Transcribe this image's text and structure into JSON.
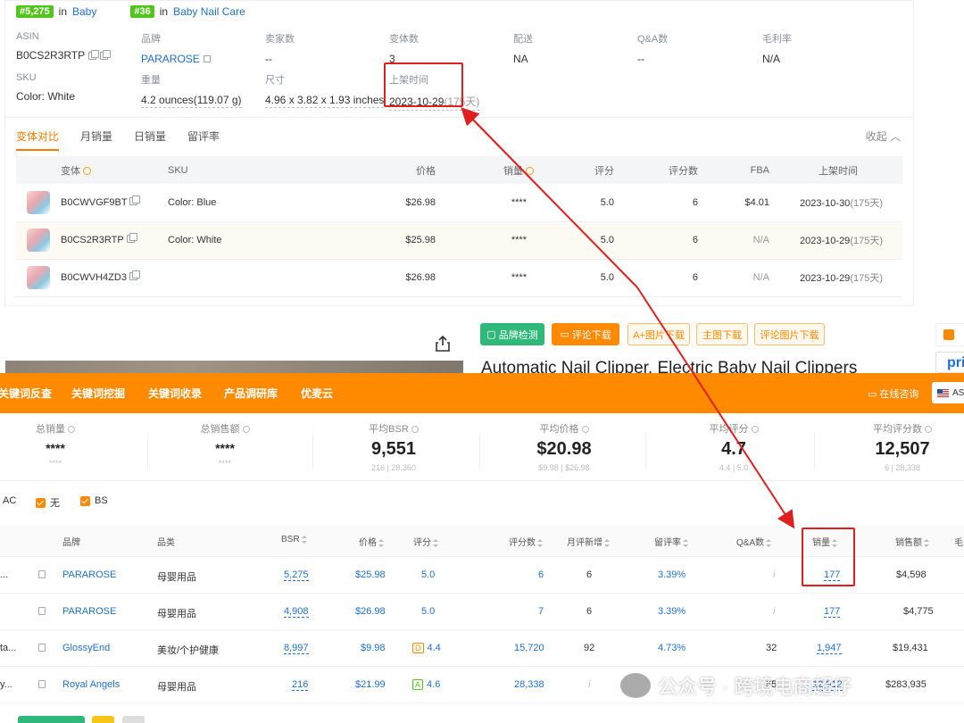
{
  "ranks": [
    {
      "rank": "#5,275",
      "in": "in",
      "category": "Baby"
    },
    {
      "rank": "#36",
      "in": "in",
      "category": "Baby Nail Care"
    }
  ],
  "info": {
    "asin": {
      "label": "ASIN",
      "value": "B0CS2R3RTP"
    },
    "brand": {
      "label": "品牌",
      "value": "PARAROSE"
    },
    "seller_count": {
      "label": "卖家数",
      "value": "--"
    },
    "variant_count": {
      "label": "变体数",
      "value": "3"
    },
    "delivery": {
      "label": "配送",
      "value": "NA"
    },
    "qa_count": {
      "label": "Q&A数",
      "value": "--"
    },
    "margin": {
      "label": "毛利率",
      "value": "N/A"
    },
    "sku": {
      "label": "SKU",
      "value": "Color: White"
    },
    "weight": {
      "label": "重量",
      "value": "4.2 ounces(119.07 g)"
    },
    "size": {
      "label": "尺寸",
      "value": "4.96 x 3.82 x 1.93 inches"
    },
    "listing_date": {
      "label": "上架时间",
      "value": "2023-10-29",
      "suffix": "(175天)"
    }
  },
  "tabs": [
    "变体对比",
    "月销量",
    "日销量",
    "留评率"
  ],
  "collapse_label": "收起",
  "variant_table": {
    "headers": [
      "变体",
      "SKU",
      "价格",
      "销量",
      "评分",
      "评分数",
      "FBA",
      "上架时间"
    ],
    "rows": [
      {
        "asin": "B0CWVGF9BT",
        "sku": "Color: Blue",
        "price": "$26.98",
        "sales": "****",
        "rating": "5.0",
        "reviews": "6",
        "fba": "$4.01",
        "date": "2023-10-30",
        "days": "(175天)"
      },
      {
        "asin": "B0CS2R3RTP",
        "sku": "Color: White",
        "price": "$25.98",
        "sales": "****",
        "rating": "5.0",
        "reviews": "6",
        "fba": "N/A",
        "date": "2023-10-29",
        "days": "(175天)"
      },
      {
        "asin": "B0CWVH4ZD3",
        "sku": "",
        "price": "$26.98",
        "sales": "****",
        "rating": "5.0",
        "reviews": "6",
        "fba": "N/A",
        "date": "2023-10-29",
        "days": "(175天)"
      }
    ]
  },
  "tool_buttons": [
    "品牌检测",
    "评论下载",
    "A+图片下载",
    "主图下载",
    "评论图片下载"
  ],
  "product_title": "Automatic Nail Clipper, Electric Baby Nail Clippers",
  "right_card_text": "pri",
  "nav": {
    "items": [
      "关键词反查",
      "关键词挖掘",
      "关键词收录",
      "产品调研库",
      "优麦云"
    ],
    "consult": "在线咨询",
    "country": "AS"
  },
  "stats": [
    {
      "label": "总销量",
      "value": "****",
      "sub": "****"
    },
    {
      "label": "总销售额",
      "value": "****",
      "sub": "****"
    },
    {
      "label": "平均BSR",
      "value": "9,551",
      "sub": "216 | 28,360"
    },
    {
      "label": "平均价格",
      "value": "$20.98",
      "sub": "$9.98 | $26.98"
    },
    {
      "label": "平均评分",
      "value": "4.7",
      "sub": "4.4 | 5.0"
    },
    {
      "label": "平均评分数",
      "value": "12,507",
      "sub": "6 | 28,338"
    }
  ],
  "filters": [
    "AC",
    "无",
    "BS"
  ],
  "main_table": {
    "headers": [
      "品牌",
      "品类",
      "BSR",
      "价格",
      "评分",
      "评分数",
      "月评新增",
      "留评率",
      "Q&A数",
      "销量",
      "销售额",
      "毛"
    ],
    "rows": [
      {
        "lead": "...",
        "brand": "PARAROSE",
        "category": "母婴用品",
        "bsr": "5,275",
        "price": "$25.98",
        "badge": "",
        "rating": "5.0",
        "reviews": "6",
        "monthly": "6",
        "rate": "3.39%",
        "qa": "i",
        "sales": "177",
        "revenue": "$4,598"
      },
      {
        "lead": "",
        "brand": "PARAROSE",
        "category": "母婴用品",
        "bsr": "4,908",
        "price": "$26.98",
        "badge": "",
        "rating": "5.0",
        "reviews": "7",
        "monthly": "6",
        "rate": "3.39%",
        "qa": "i",
        "sales": "177",
        "revenue": "$4,775"
      },
      {
        "lead": "ta...",
        "brand": "GlossyEnd",
        "category": "美妆/个护健康",
        "bsr": "8,997",
        "price": "$9.98",
        "badge": "D",
        "rating": "4.4",
        "reviews": "15,720",
        "monthly": "92",
        "rate": "4.73%",
        "qa": "32",
        "sales": "1,947",
        "revenue": "$19,431"
      },
      {
        "lead": "y...",
        "brand": "Royal Angels",
        "category": "母婴用品",
        "bsr": "216",
        "price": "$21.99",
        "badge": "A",
        "rating": "4.6",
        "reviews": "28,338",
        "monthly": "i",
        "rate": "",
        "qa": "65",
        "sales": "12,912",
        "revenue": "$283,935"
      }
    ]
  },
  "watermark": "公众号 · 跨境电商超仔",
  "colors": {
    "accent": "#ff8a00",
    "link": "#1f6fd0",
    "highlight": "#e02020",
    "green": "#52c41a"
  }
}
